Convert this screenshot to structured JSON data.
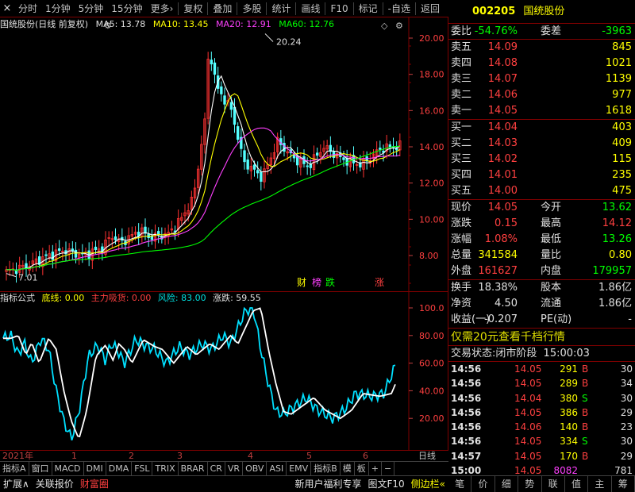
{
  "toolbar": {
    "items": [
      "分时",
      "1分钟",
      "5分钟",
      "15分钟",
      "更多",
      "复权",
      "叠加",
      "多股",
      "统计",
      "画线",
      "F10",
      "标记",
      "-自选",
      "返回"
    ],
    "more_arrow": "›",
    "close": "×"
  },
  "main": {
    "title": "国统股份(日线 前复权)",
    "ma5": "MA5: 13.78",
    "ma10": "MA10: 13.45",
    "ma20": "MA20: 12.91",
    "ma60": "MA60: 12.76",
    "high_label": "20.24",
    "low_label": "7.01",
    "price_axis": [
      "20.00",
      "18.00",
      "16.00",
      "14.00",
      "12.00",
      "10.00",
      "8.00"
    ],
    "markers": [
      "财",
      "榜",
      "跌",
      "涨"
    ],
    "colors": {
      "ma5": "#ffffff",
      "ma10": "#ffff00",
      "ma20": "#ff40ff",
      "ma60": "#00ff00"
    }
  },
  "indicator": {
    "name": "指标公式",
    "dixian": "底线: 0.00",
    "zhuli": "主力吸货: 0.00",
    "fengxian": "风险: 83.00",
    "zhangdie": "涨跌: 59.55",
    "axis": [
      "100.0",
      "80.00",
      "60.00",
      "40.00",
      "20.00"
    ]
  },
  "date_axis": {
    "labels": [
      "2021年",
      "1",
      "2",
      "3",
      "4",
      "5",
      "6"
    ],
    "right": "日线"
  },
  "tabs": [
    "指标A",
    "窗口",
    "MACD",
    "DMI",
    "DMA",
    "FSL",
    "TRIX",
    "BRAR",
    "CR",
    "VR",
    "OBV",
    "ASI",
    "EMV",
    "指标B",
    "模",
    "板",
    "+",
    "−"
  ],
  "bottombar": {
    "left": [
      "扩展∧",
      "关联报价",
      "财富圈"
    ],
    "right": [
      "新用户福利专享",
      "图文F10",
      "侧边栏«"
    ]
  },
  "quote": {
    "code": "002205",
    "name": "国统股份",
    "weibi_label": "委比",
    "weibi": "-54.76%",
    "weicha_label": "委差",
    "weicha": "-3963",
    "asks": [
      {
        "label": "卖五",
        "price": "14.09",
        "vol": "845"
      },
      {
        "label": "卖四",
        "price": "14.08",
        "vol": "1021"
      },
      {
        "label": "卖三",
        "price": "14.07",
        "vol": "1139"
      },
      {
        "label": "卖二",
        "price": "14.06",
        "vol": "977"
      },
      {
        "label": "卖一",
        "price": "14.05",
        "vol": "1618"
      }
    ],
    "bids": [
      {
        "label": "买一",
        "price": "14.04",
        "vol": "403"
      },
      {
        "label": "买二",
        "price": "14.03",
        "vol": "409"
      },
      {
        "label": "买三",
        "price": "14.02",
        "vol": "115"
      },
      {
        "label": "买四",
        "price": "14.01",
        "vol": "235"
      },
      {
        "label": "买五",
        "price": "14.00",
        "vol": "475"
      }
    ],
    "stats1": [
      {
        "l1": "现价",
        "v1": "14.05",
        "l2": "今开",
        "v2": "13.62"
      },
      {
        "l1": "涨跌",
        "v1": "0.15",
        "l2": "最高",
        "v2": "14.12"
      },
      {
        "l1": "涨幅",
        "v1": "1.08%",
        "l2": "最低",
        "v2": "13.26"
      },
      {
        "l1": "总量",
        "v1": "341584",
        "l2": "量比",
        "v2": "0.80"
      },
      {
        "l1": "外盘",
        "v1": "161627",
        "l2": "内盘",
        "v2": "179957"
      }
    ],
    "stats2": [
      {
        "l1": "换手",
        "v1": "18.38%",
        "l2": "股本",
        "v2": "1.86亿"
      },
      {
        "l1": "净资",
        "v1": "4.50",
        "l2": "流通",
        "v2": "1.86亿"
      },
      {
        "l1": "收益(一)",
        "v1": "-0.207",
        "l2": "PE(动)",
        "v2": "-"
      }
    ],
    "promo": "仅需20元查看千档行情",
    "status_label": "交易状态:",
    "status_value": "闭市阶段",
    "status_time": "15:00:03",
    "ticks": [
      {
        "t": "14:56",
        "p": "14.05",
        "v": "291",
        "bs": "B",
        "n": "30"
      },
      {
        "t": "14:56",
        "p": "14.05",
        "v": "289",
        "bs": "B",
        "n": "34"
      },
      {
        "t": "14:56",
        "p": "14.04",
        "v": "380",
        "bs": "S",
        "n": "30"
      },
      {
        "t": "14:56",
        "p": "14.05",
        "v": "386",
        "bs": "B",
        "n": "29"
      },
      {
        "t": "14:56",
        "p": "14.06",
        "v": "140",
        "bs": "B",
        "n": "23"
      },
      {
        "t": "14:56",
        "p": "14.05",
        "v": "334",
        "bs": "S",
        "n": "30"
      },
      {
        "t": "14:57",
        "p": "14.05",
        "v": "170",
        "bs": "B",
        "n": "29"
      },
      {
        "t": "15:00",
        "p": "14.05",
        "v": "8082",
        "bs": "",
        "n": "781"
      }
    ],
    "rtabs": [
      "笔",
      "价",
      "细",
      "势",
      "联",
      "值",
      "主",
      "筹"
    ]
  }
}
